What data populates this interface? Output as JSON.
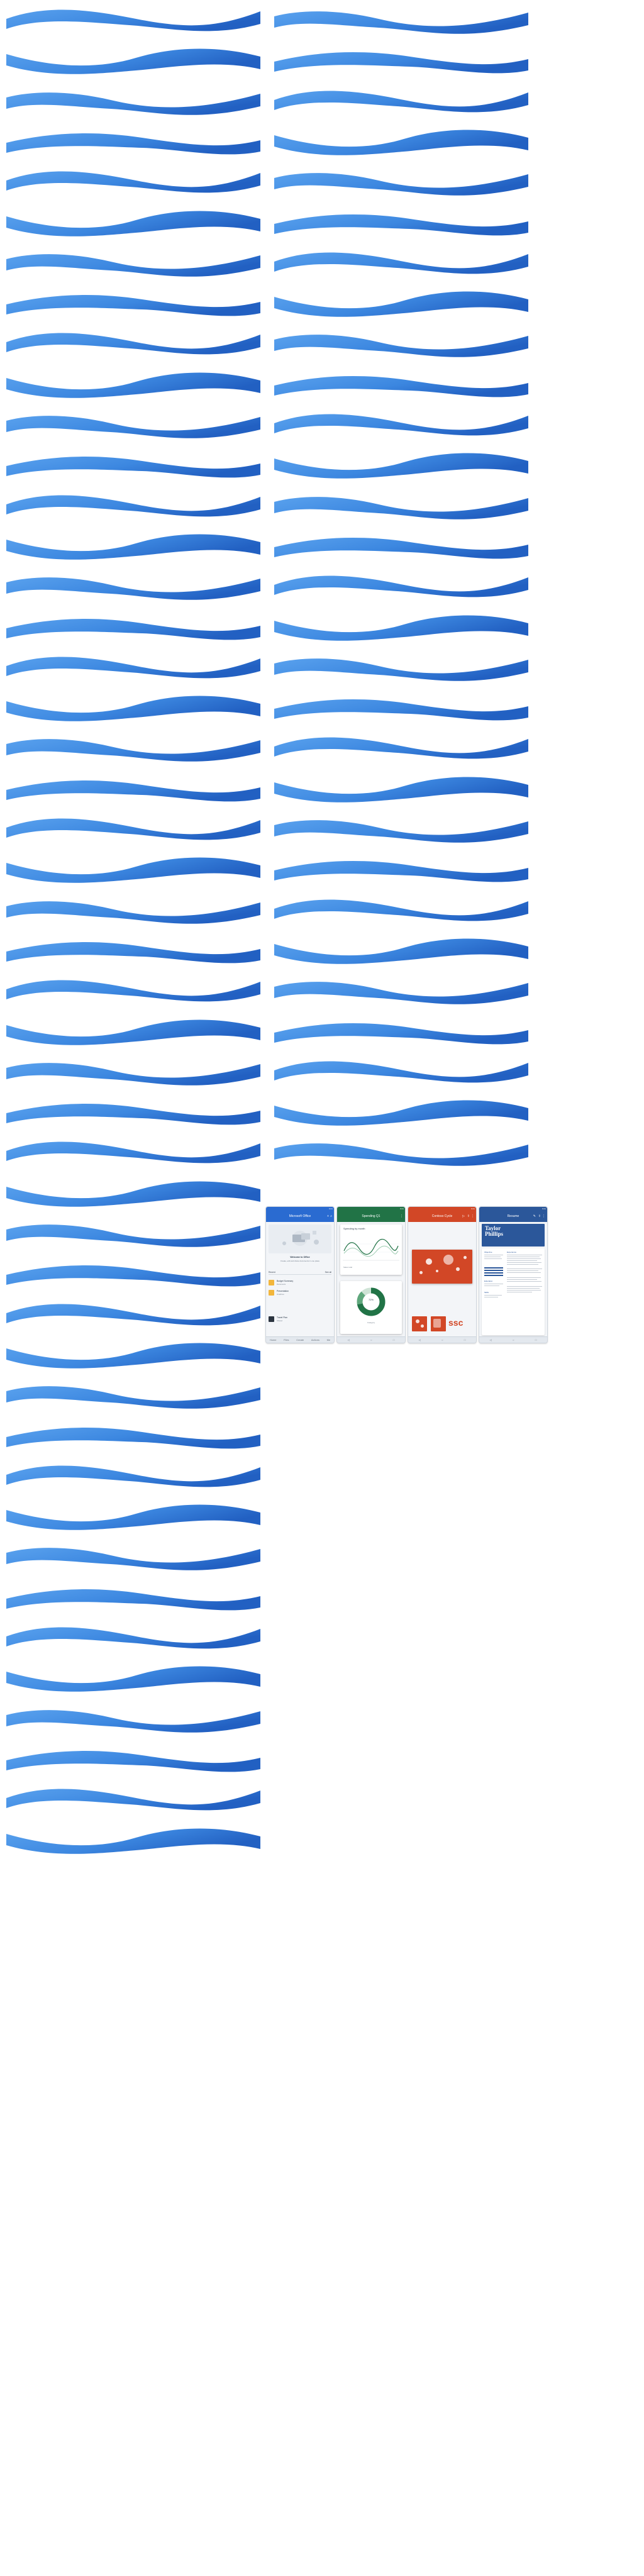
{
  "colors": {
    "wave_light": "#5aa2ee",
    "wave_mid": "#3c87e0",
    "wave_dark": "#2260c2",
    "office_accent": "#2a6bd1",
    "excel_accent": "#217346",
    "powerpoint_accent": "#d24726",
    "word_accent": "#2b579a"
  },
  "phones": {
    "office": {
      "time": "9:41",
      "appbar_title": "Microsoft Office",
      "hero_title": "Welcome to Office",
      "hero_subtitle": "Create, edit and share documents in one place",
      "section_label": "Recent",
      "section_action": "See all",
      "files": [
        {
          "name": "Budget Summary",
          "sub": "Documents",
          "icon": "excel-icon"
        },
        {
          "name": "Presentation",
          "sub": "OneDrive",
          "icon": "folder-icon"
        },
        {
          "name": "Travel Plan",
          "sub": "Shared",
          "icon": "word-icon"
        }
      ],
      "nav": [
        "Home",
        "Files",
        "Create",
        "Actions",
        "Me"
      ]
    },
    "excel": {
      "time": "9:41",
      "appbar_title": "Spending Q1",
      "card_title": "Spending by month",
      "card_footer": "Sales total",
      "donut_label": "Category",
      "donut_value": "72%"
    },
    "powerpoint": {
      "time": "9:41",
      "appbar_title": "Contoso Cycle",
      "big_text": "ssc"
    },
    "word": {
      "time": "9:41",
      "appbar_title": "Resume",
      "name_line1": "Taylor",
      "name_line2": "Phillips",
      "sections": [
        "Objective",
        "Experience",
        "Education",
        "Skills"
      ]
    }
  }
}
